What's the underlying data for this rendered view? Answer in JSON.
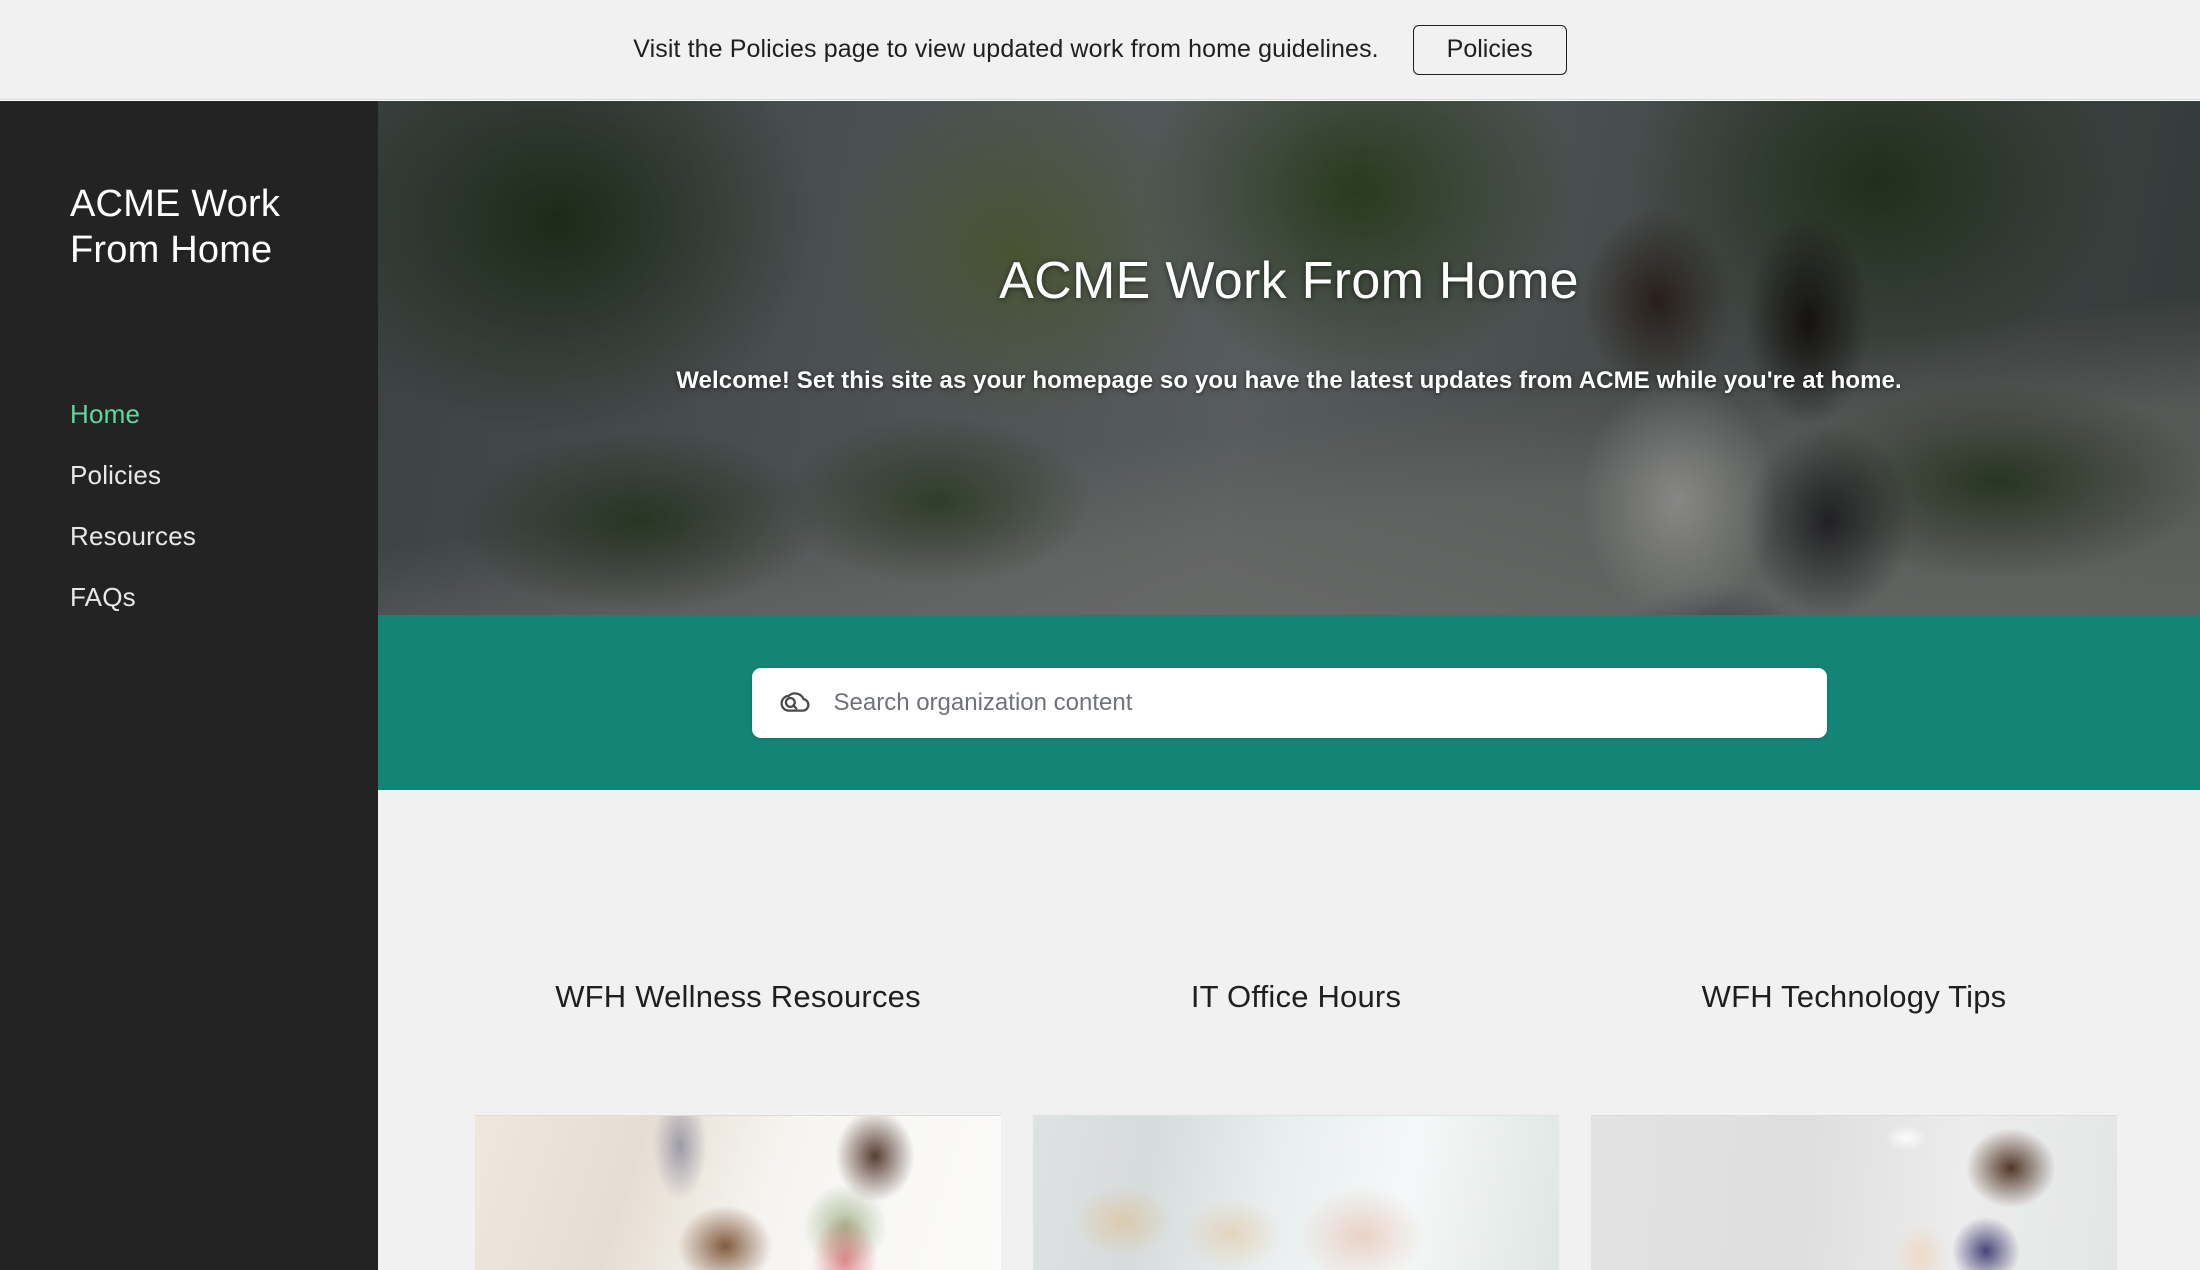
{
  "banner": {
    "message": "Visit the Policies page to view updated work from home guidelines.",
    "button_label": "Policies"
  },
  "sidebar": {
    "site_title": "ACME Work From Home",
    "items": [
      {
        "label": "Home",
        "active": true
      },
      {
        "label": "Policies",
        "active": false
      },
      {
        "label": "Resources",
        "active": false
      },
      {
        "label": "FAQs",
        "active": false
      }
    ]
  },
  "hero": {
    "title": "ACME Work From Home",
    "subtitle": "Welcome! Set this site as your homepage so you have the latest updates from ACME while you're at home."
  },
  "search": {
    "icon": "cloud-search-icon",
    "placeholder": "Search organization content",
    "value": ""
  },
  "cards": [
    {
      "title": "WFH Wellness Resources",
      "image": "people-celebrating-photo"
    },
    {
      "title": "IT Office Hours",
      "image": "blurred-office-interior-photo"
    },
    {
      "title": "WFH Technology Tips",
      "image": "woman-polka-dot-top-photo"
    }
  ],
  "colors": {
    "banner_background": "#f1f1f1",
    "sidebar_background": "#232323",
    "accent_green": "#5fd89c",
    "search_band_teal": "#138576",
    "content_background": "#f1f1f1",
    "text_dark": "#1f1f1f"
  }
}
